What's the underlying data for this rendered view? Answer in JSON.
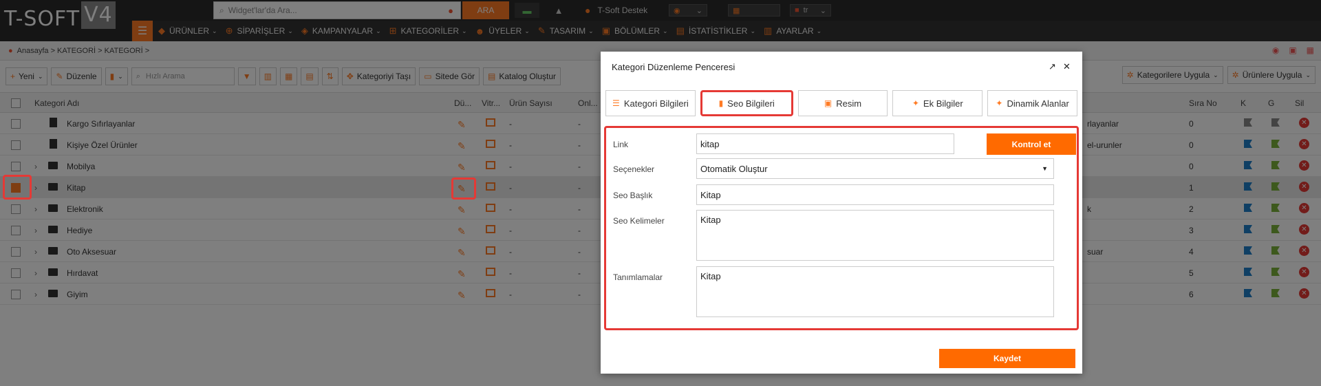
{
  "app": {
    "logo_text": "T-SOFT",
    "logo_version": "V4"
  },
  "topbar": {
    "search_placeholder": "Widget'lar'da Ara...",
    "search_button": "ARA",
    "user_label": "T-Soft Destek",
    "language": "tr"
  },
  "nav": {
    "items": [
      {
        "label": "ÜRÜNLER",
        "icon": "tag-icon"
      },
      {
        "label": "SİPARİŞLER",
        "icon": "cart-icon"
      },
      {
        "label": "KAMPANYALAR",
        "icon": "ticket-icon"
      },
      {
        "label": "KATEGORİLER",
        "icon": "sitemap-icon"
      },
      {
        "label": "ÜYELER",
        "icon": "users-icon"
      },
      {
        "label": "TASARIM",
        "icon": "brush-icon"
      },
      {
        "label": "BÖLÜMLER",
        "icon": "sections-icon"
      },
      {
        "label": "İSTATİSTİKLER",
        "icon": "chart-icon"
      },
      {
        "label": "AYARLAR",
        "icon": "settings-icon"
      }
    ]
  },
  "breadcrumb": "Anasayfa > KATEGORİ > KATEGORİ >",
  "toolbar": {
    "new_label": "Yeni",
    "edit_label": "Düzenle",
    "search_placeholder": "Hızlı Arama",
    "move_label": "Kategoriyi Taşı",
    "site_label": "Sitede Gör",
    "catalog_label": "Katalog Oluştur",
    "apply_categories": "Kategorilere Uygula",
    "apply_products": "Ürünlere Uygula"
  },
  "table": {
    "headers": {
      "name": "Kategori Adı",
      "edit": "Dü...",
      "showcase": "Vitr...",
      "product_count": "Ürün Sayısı",
      "online": "Onl...",
      "order": "Sıra No",
      "k": "K",
      "g": "G",
      "delete": "Sil"
    },
    "rows": [
      {
        "name": "Kargo Sıfırlayanlar",
        "count": "-",
        "online": "-",
        "hidden": "rlayanlar",
        "order": "0",
        "type": "doc",
        "checked": false
      },
      {
        "name": "Kişiye Özel Ürünler",
        "count": "-",
        "online": "-",
        "hidden": "el-urunler",
        "order": "0",
        "type": "doc",
        "checked": false
      },
      {
        "name": "Mobilya",
        "count": "-",
        "online": "-",
        "hidden": "",
        "order": "0",
        "type": "folder",
        "checked": false
      },
      {
        "name": "Kitap",
        "count": "-",
        "online": "-",
        "hidden": "",
        "order": "1",
        "type": "folder",
        "checked": true
      },
      {
        "name": "Elektronik",
        "count": "-",
        "online": "-",
        "hidden": "k",
        "order": "2",
        "type": "folder",
        "checked": false
      },
      {
        "name": "Hediye",
        "count": "-",
        "online": "-",
        "hidden": "",
        "order": "3",
        "type": "folder",
        "checked": false
      },
      {
        "name": "Oto Aksesuar",
        "count": "-",
        "online": "-",
        "hidden": "suar",
        "order": "4",
        "type": "folder",
        "checked": false
      },
      {
        "name": "Hırdavat",
        "count": "-",
        "online": "-",
        "hidden": "",
        "order": "5",
        "type": "folder",
        "checked": false
      },
      {
        "name": "Giyim",
        "count": "-",
        "online": "-",
        "hidden": "",
        "order": "6",
        "type": "folder",
        "checked": false
      }
    ]
  },
  "modal": {
    "title": "Kategori Düzenleme Penceresi",
    "tabs": [
      {
        "label": "Kategori Bilgileri",
        "icon": "list-icon"
      },
      {
        "label": "Seo Bilgileri",
        "icon": "bookmark-icon"
      },
      {
        "label": "Resim",
        "icon": "image-icon"
      },
      {
        "label": "Ek Bilgiler",
        "icon": "magic-icon"
      },
      {
        "label": "Dinamik Alanlar",
        "icon": "magic-icon"
      }
    ],
    "active_tab": "Seo Bilgileri",
    "fields": {
      "link_label": "Link",
      "link_value": "kitap",
      "check_button": "Kontrol et",
      "options_label": "Seçenekler",
      "options_value": "Otomatik Oluştur",
      "seo_title_label": "Seo Başlık",
      "seo_title_value": "Kitap",
      "seo_keywords_label": "Seo Kelimeler",
      "seo_keywords_value": "Kitap",
      "descriptions_label": "Tanımlamalar",
      "descriptions_value": "Kitap"
    },
    "save_button": "Kaydet"
  },
  "colors": {
    "accent": "#ff7b24",
    "highlight": "#e53935",
    "topbar": "#2b2b2b"
  }
}
